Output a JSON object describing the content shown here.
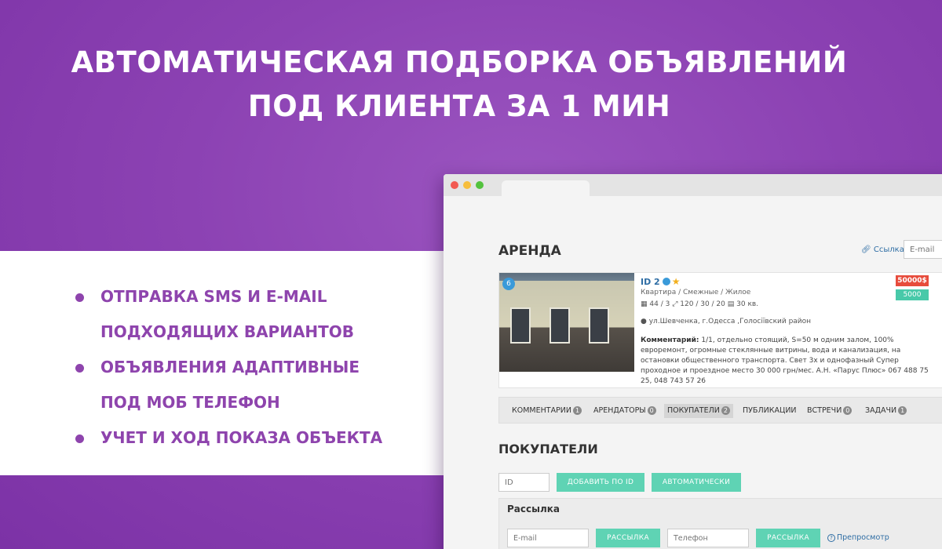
{
  "headline": {
    "line1": "АВТОМАТИЧЕСКАЯ ПОДБОРКА ОБЪЯВЛЕНИЙ",
    "line2": "ПОД КЛИЕНТА ЗА 1 МИН"
  },
  "features": [
    {
      "line1": "ОТПРАВКА SMS И E-MAIL",
      "line2": "ПОДХОДЯЩИХ ВАРИАНТОВ"
    },
    {
      "line1": "ОБЪЯВЛЕНИЯ АДАПТИВНЫЕ",
      "line2": "ПОД МОБ ТЕЛЕФОН"
    },
    {
      "line1": "УЧЕТ И ХОД ПОКАЗА ОБЪЕКТА"
    }
  ],
  "app": {
    "title": "АРЕНДА",
    "link_label": "Ссылка",
    "email_placeholder": "E-mail",
    "listing": {
      "photo_count": "6",
      "id": "ID 2",
      "type": "Квартира / Смежные / Жилое",
      "area": "44 / 3",
      "size": "120 / 30 / 20",
      "area_kv": "30 кв.",
      "address": "ул.Шевченка, г.Одесса ,Голосіївский район",
      "comment_label": "Комментарий:",
      "comment": "1/1, отдельно стоящий, S=50 м одним залом, 100% евроремонт, огромные стеклянные витрины, вода и канализация, на остановки общественного транспорта. Свет 3х и однофазный Супер проходное и проездное место 30 000 грн/мес. А.Н. «Парус Плюс» 067 488 75 25, 048 743 57 26",
      "price_usd": "50000$",
      "price_uah": "5000 грн"
    },
    "tabs": [
      {
        "label": "КОММЕНТАРИИ",
        "count": "1"
      },
      {
        "label": "АРЕНДАТОРЫ",
        "count": "0"
      },
      {
        "label": "ПОКУПАТЕЛИ",
        "count": "2"
      },
      {
        "label": "ПУБЛИКАЦИИ",
        "count": ""
      },
      {
        "label": "ВСТРЕЧИ",
        "count": "0"
      },
      {
        "label": "ЗАДАЧИ",
        "count": "1"
      }
    ],
    "section_title": "ПОКУПАТЕЛИ",
    "id_placeholder": "ID",
    "add_by_id": "ДОБАВИТЬ ПО ID",
    "auto": "АВТОМАТИЧЕСКИ",
    "mailing": {
      "title": "Рассылка",
      "email_placeholder": "E-mail",
      "send_label": "РАССЫЛКА",
      "phone_placeholder": "Телефон",
      "send_label2": "РАССЫЛКА",
      "preview": "Препросмотр"
    }
  },
  "colors": {
    "brand": "#8e44ad",
    "teal_button": "#5fd3b4",
    "price_red": "#e74c3c",
    "link_blue": "#2e6da4"
  }
}
